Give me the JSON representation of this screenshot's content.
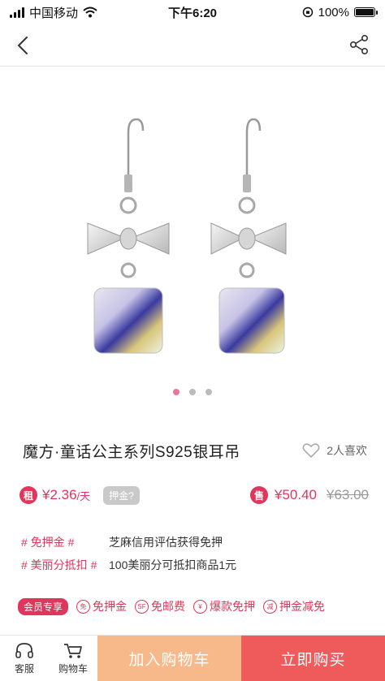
{
  "status_bar": {
    "carrier": "中国移动",
    "time": "下午6:20",
    "battery_text": "100%",
    "icons": [
      "signal-icon",
      "wifi-icon",
      "orientation-lock-icon",
      "battery-icon"
    ]
  },
  "nav": {
    "back_icon": "chevron-left-icon",
    "share_icon": "share-icon"
  },
  "gallery": {
    "image": "earrings-photo",
    "dot_count": 3,
    "active_index": 0
  },
  "product": {
    "title": "魔方·童话公主系列S925银耳吊",
    "likes": "2人喜欢"
  },
  "pricing": {
    "rent_tag": "租",
    "rent_price": "¥2.36",
    "rent_unit": "/天",
    "deposit_chip": "押金?",
    "sale_tag": "售",
    "sale_price": "¥50.40",
    "original_price": "¥63.00"
  },
  "perks": [
    {
      "tag": "# 免押金 #",
      "desc": "芝麻信用评估获得免押"
    },
    {
      "tag": "# 美丽分抵扣 #",
      "desc": "100美丽分可抵扣商品1元"
    }
  ],
  "promos": {
    "vip": "会员专享",
    "items": [
      {
        "icon": "免",
        "label": "免押金"
      },
      {
        "icon": "SF",
        "label": "免邮费"
      },
      {
        "icon": "¥",
        "label": "爆款免押"
      },
      {
        "icon": "减",
        "label": "押金减免"
      }
    ]
  },
  "bottom_bar": {
    "service_label": "客服",
    "cart_label": "购物车",
    "add_to_cart": "加入购物车",
    "buy_now": "立即购买"
  },
  "colors": {
    "accent": "#e0365c",
    "cart_button": "#f8b98a",
    "buy_button": "#ef5b5b"
  }
}
